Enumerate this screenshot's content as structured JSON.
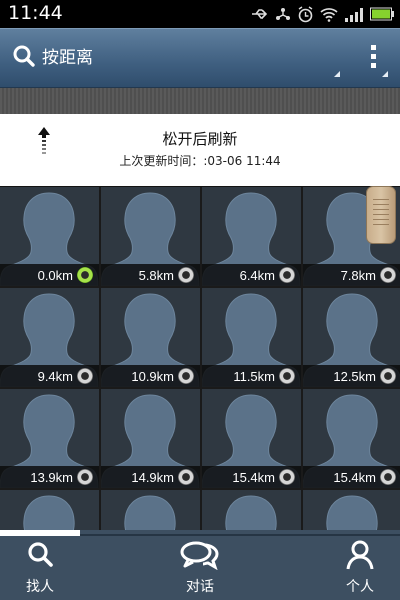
{
  "status_bar": {
    "time": "11:44",
    "icons": [
      "usb-icon",
      "share-icon",
      "alarm-icon",
      "wifi-icon",
      "signal-icon",
      "battery-icon"
    ]
  },
  "header": {
    "title": "按距离",
    "search_icon": "search-icon",
    "menu_icon": "overflow-menu-icon"
  },
  "refresh": {
    "message": "松开后刷新",
    "last_update": "上次更新时间：:03-06 11:44"
  },
  "people": [
    {
      "distance": "0.0km",
      "online": true
    },
    {
      "distance": "5.8km",
      "online": false
    },
    {
      "distance": "6.4km",
      "online": false
    },
    {
      "distance": "7.8km",
      "online": false
    },
    {
      "distance": "9.4km",
      "online": false
    },
    {
      "distance": "10.9km",
      "online": false
    },
    {
      "distance": "11.5km",
      "online": false
    },
    {
      "distance": "12.5km",
      "online": false
    },
    {
      "distance": "13.9km",
      "online": false
    },
    {
      "distance": "14.9km",
      "online": false
    },
    {
      "distance": "15.4km",
      "online": false
    },
    {
      "distance": "15.4km",
      "online": false
    },
    {
      "distance": "",
      "online": false
    },
    {
      "distance": "",
      "online": false
    },
    {
      "distance": "",
      "online": false
    },
    {
      "distance": "",
      "online": false
    }
  ],
  "bottom_nav": {
    "tabs": [
      {
        "label": "找人",
        "icon": "search-icon"
      },
      {
        "label": "对话",
        "icon": "chat-bubbles-icon"
      },
      {
        "label": "个人",
        "icon": "person-icon"
      }
    ]
  },
  "colors": {
    "header_blue": "#3f5f80",
    "online_green": "#a6e24a",
    "avatar_placeholder": "#5b7289"
  }
}
